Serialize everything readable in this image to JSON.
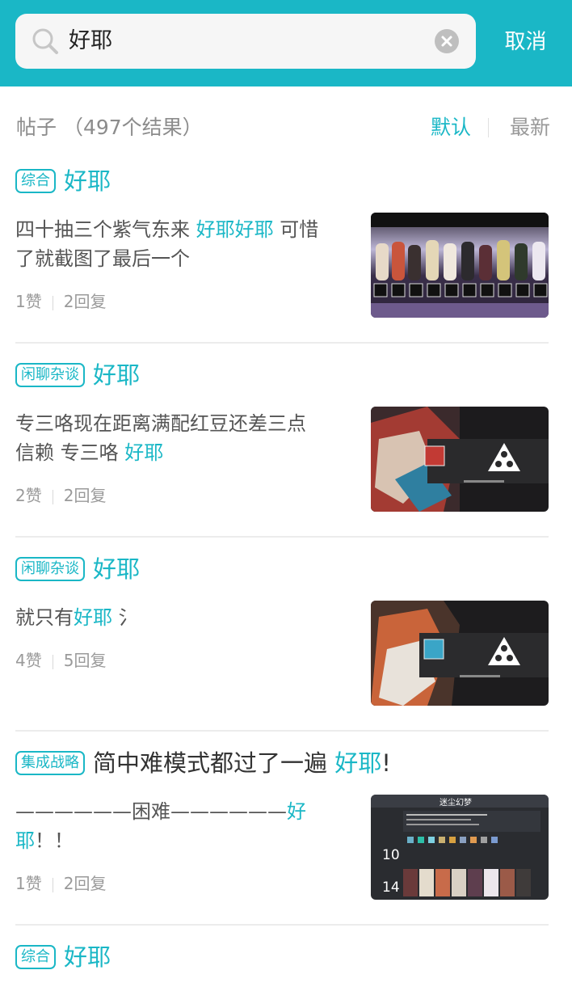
{
  "search": {
    "query": "好耶",
    "cancel_label": "取消"
  },
  "results": {
    "label": "帖子 （497个结果）",
    "sort_default": "默认",
    "sort_newest": "最新"
  },
  "posts": [
    {
      "tag": "综合",
      "title_prefix": "",
      "title_hl": "好耶",
      "title_suffix": "",
      "excerpt_lines": [
        {
          "a": "四十抽三个紫气东来 ",
          "hl": "好耶好耶",
          "b": " 可惜"
        },
        {
          "a": "了就截图了最后一个",
          "hl": "",
          "b": ""
        }
      ],
      "likes": "1赞",
      "replies": "2回复",
      "thumb_icon": "character-roster-screenshot"
    },
    {
      "tag": "闲聊杂谈",
      "title_prefix": "",
      "title_hl": "好耶",
      "title_suffix": "",
      "excerpt_lines": [
        {
          "a": "专三咯现在距离满配红豆还差三点",
          "hl": "",
          "b": ""
        },
        {
          "a": "信赖 专三咯 ",
          "hl": "好耶",
          "b": ""
        }
      ],
      "likes": "2赞",
      "replies": "2回复",
      "thumb_icon": "operator-skill-screenshot"
    },
    {
      "tag": "闲聊杂谈",
      "title_prefix": "",
      "title_hl": "好耶",
      "title_suffix": "",
      "excerpt_lines": [
        {
          "a": "就只有",
          "hl": "好耶",
          "b": " 氵"
        }
      ],
      "likes": "4赞",
      "replies": "5回复",
      "thumb_icon": "operator-skill-screenshot"
    },
    {
      "tag": "集成战略",
      "title_prefix": "简中难模式都过了一遍 ",
      "title_hl": "好耶",
      "title_suffix": "!",
      "excerpt_lines": [
        {
          "a": "——————困难——————",
          "hl": "好",
          "b": ""
        },
        {
          "a": "",
          "hl": "耶",
          "b": "！！"
        }
      ],
      "likes": "1赞",
      "replies": "2回复",
      "thumb_icon": "roguelike-summary-screenshot",
      "thumb_texts": [
        "迷尘幻梦",
        "10",
        "14"
      ]
    },
    {
      "tag": "综合",
      "title_prefix": "",
      "title_hl": "好耶",
      "title_suffix": ""
    }
  ],
  "colors": {
    "accent": "#1ab7c6",
    "text": "#333333",
    "muted": "#9a9a9a"
  }
}
